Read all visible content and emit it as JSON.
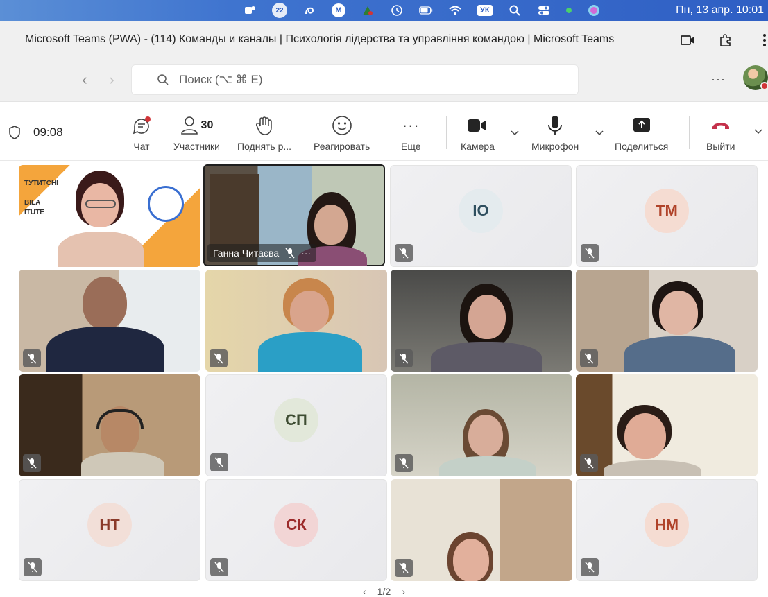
{
  "menubar": {
    "badge_count": "22",
    "m_label": "M",
    "lang": "УК",
    "datetime": "Пн, 13 апр.  10:01"
  },
  "window": {
    "title": "Microsoft Teams (PWA) - (114) Команды и каналы | Психологія лідерства та управління командою | Microsoft Teams"
  },
  "nav": {
    "back": "‹",
    "forward": "›",
    "search_placeholder": "Поиск (⌥ ⌘ E)",
    "more": "···"
  },
  "meeting": {
    "timer": "09:08",
    "chat_label": "Чат",
    "participants_label": "Участники",
    "participants_count": "30",
    "raise_hand_label": "Поднять р...",
    "react_label": "Реагировать",
    "more_label": "Еще",
    "more_glyph": "···",
    "camera_label": "Камера",
    "mic_label": "Микрофон",
    "share_label": "Поделиться",
    "leave_label": "Выйти"
  },
  "tiles": [
    {
      "type": "video",
      "presenter": true
    },
    {
      "type": "video",
      "name": "Ганна Читаєва",
      "more": "···"
    },
    {
      "type": "initials",
      "initials": "IO",
      "bg": "#e4ebee",
      "fg": "#2f4f5f"
    },
    {
      "type": "initials",
      "initials": "TM",
      "bg": "#f5dcd2",
      "fg": "#b0432a"
    },
    {
      "type": "video"
    },
    {
      "type": "video"
    },
    {
      "type": "video"
    },
    {
      "type": "video"
    },
    {
      "type": "video"
    },
    {
      "type": "initials",
      "initials": "СП",
      "bg": "#e2e8da",
      "fg": "#3e4d33"
    },
    {
      "type": "video"
    },
    {
      "type": "video"
    },
    {
      "type": "initials",
      "initials": "НТ",
      "bg": "#f2dfd8",
      "fg": "#8a3a2a"
    },
    {
      "type": "initials",
      "initials": "СК",
      "bg": "#f2d5d5",
      "fg": "#9c2a2a"
    },
    {
      "type": "video"
    },
    {
      "type": "initials",
      "initials": "НМ",
      "bg": "#f5dcd2",
      "fg": "#b0432a"
    }
  ],
  "presenter_slide": {
    "line1": "ТУТИТСНІ",
    "line2": "BILA",
    "line3": "ITUTE"
  },
  "pager": {
    "prev": "‹",
    "page": "1/2",
    "next": "›"
  }
}
